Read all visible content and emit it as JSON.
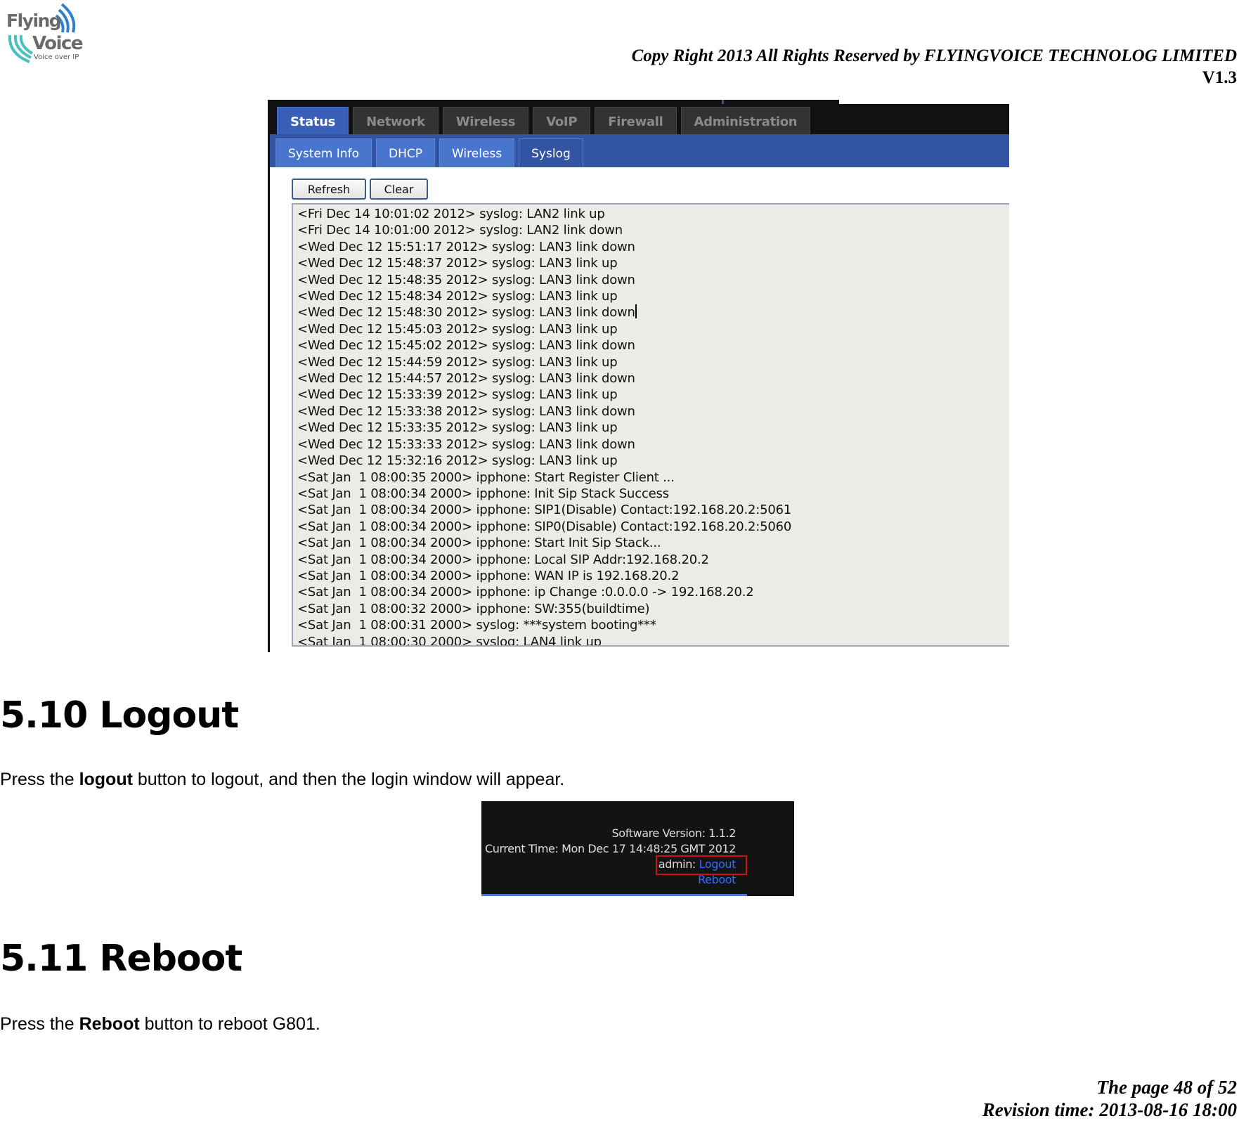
{
  "header": {
    "logo_text": "Flying Voice",
    "logo_tagline": "Voice over IP",
    "copyright": "Copy Right 2013 All Rights Reserved by FLYINGVOICE TECHNOLOG LIMITED",
    "version": "V1.3"
  },
  "syslog_screenshot": {
    "main_tabs": [
      {
        "label": "Status",
        "active": true
      },
      {
        "label": "Network"
      },
      {
        "label": "Wireless"
      },
      {
        "label": "VoIP"
      },
      {
        "label": "Firewall"
      },
      {
        "label": "Administration"
      }
    ],
    "sub_tabs": [
      {
        "label": "System Info"
      },
      {
        "label": "DHCP"
      },
      {
        "label": "Wireless"
      },
      {
        "label": "Syslog",
        "active": true
      }
    ],
    "refresh_label": "Refresh",
    "clear_label": "Clear",
    "log_lines": [
      "<Fri Dec 14 10:01:02 2012> syslog: LAN2 link up",
      "<Fri Dec 14 10:01:00 2012> syslog: LAN2 link down",
      "<Wed Dec 12 15:51:17 2012> syslog: LAN3 link down",
      "<Wed Dec 12 15:48:37 2012> syslog: LAN3 link up",
      "<Wed Dec 12 15:48:35 2012> syslog: LAN3 link down",
      "<Wed Dec 12 15:48:34 2012> syslog: LAN3 link up",
      "<Wed Dec 12 15:48:30 2012> syslog: LAN3 link down",
      "<Wed Dec 12 15:45:03 2012> syslog: LAN3 link up",
      "<Wed Dec 12 15:45:02 2012> syslog: LAN3 link down",
      "<Wed Dec 12 15:44:59 2012> syslog: LAN3 link up",
      "<Wed Dec 12 15:44:57 2012> syslog: LAN3 link down",
      "<Wed Dec 12 15:33:39 2012> syslog: LAN3 link up",
      "<Wed Dec 12 15:33:38 2012> syslog: LAN3 link down",
      "<Wed Dec 12 15:33:35 2012> syslog: LAN3 link up",
      "<Wed Dec 12 15:33:33 2012> syslog: LAN3 link down",
      "<Wed Dec 12 15:32:16 2012> syslog: LAN3 link up",
      "<Sat Jan  1 08:00:35 2000> ipphone: Start Register Client ...",
      "<Sat Jan  1 08:00:34 2000> ipphone: Init Sip Stack Success",
      "<Sat Jan  1 08:00:34 2000> ipphone: SIP1(Disable) Contact:192.168.20.2:5061",
      "<Sat Jan  1 08:00:34 2000> ipphone: SIP0(Disable) Contact:192.168.20.2:5060",
      "<Sat Jan  1 08:00:34 2000> ipphone: Start Init Sip Stack...",
      "<Sat Jan  1 08:00:34 2000> ipphone: Local SIP Addr:192.168.20.2",
      "<Sat Jan  1 08:00:34 2000> ipphone: WAN IP is 192.168.20.2",
      "<Sat Jan  1 08:00:34 2000> ipphone: ip Change :0.0.0.0 -> 192.168.20.2",
      "<Sat Jan  1 08:00:32 2000> ipphone: SW:355(buildtime)",
      "<Sat Jan  1 08:00:31 2000> syslog: ***system booting***",
      "<Sat Jan  1 08:00:30 2000> syslog: LAN4 link up"
    ]
  },
  "section_logout": {
    "heading": "5.10 Logout",
    "text_before": "Press the ",
    "text_bold": "logout",
    "text_after": " button to logout, and then the login window will appear."
  },
  "logout_screenshot": {
    "software_version": "Software Version: 1.1.2",
    "current_time": "Current Time: Mon Dec 17 14:48:25 GMT 2012",
    "user_label": "admin: ",
    "logout_link": "Logout",
    "reboot_link": "Reboot",
    "highlight_color": "#d01010"
  },
  "section_reboot": {
    "heading": "5.11 Reboot",
    "text_before": "Press the ",
    "text_bold": "Reboot",
    "text_after": " button to reboot G801."
  },
  "footer": {
    "page": "The page 48 of 52",
    "revision": "Revision time: 2013-08-16 18:00"
  }
}
